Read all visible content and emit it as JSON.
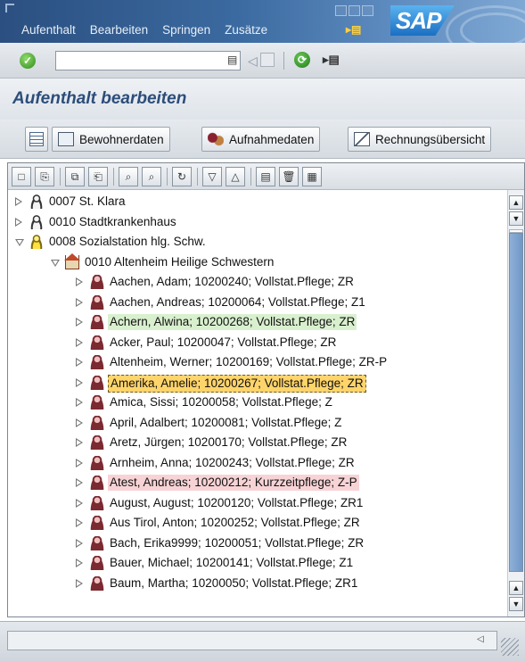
{
  "menubar": {
    "items": [
      "Aufenthalt",
      "Bearbeiten",
      "Springen",
      "Zusätze"
    ],
    "logo": "SAP",
    "accent": "#2b4f80"
  },
  "toolbar": {
    "command_value": "",
    "icons": [
      "ok-icon",
      "history-icon",
      "back-icon",
      "save-icon",
      "shortcut-icon",
      "customize-icon"
    ]
  },
  "page": {
    "title": "Aufenthalt bearbeiten"
  },
  "app_toolbar": {
    "buttons": [
      {
        "label": "",
        "icon": "list-icon"
      },
      {
        "label": "Bewohnerdaten",
        "icon": "resident-icon"
      },
      {
        "label": "Aufnahmedaten",
        "icon": "admission-icon"
      },
      {
        "label": "Rechnungsübersicht",
        "icon": "invoice-icon"
      }
    ]
  },
  "tree_toolbar": {
    "icons": [
      "new-icon",
      "detail-icon",
      "copy-icon",
      "paste-icon",
      "find-icon",
      "find-next-icon",
      "refresh-icon",
      "expand-icon",
      "collapse-icon",
      "print-icon",
      "delete-icon",
      "layout-icon"
    ]
  },
  "tree": {
    "nodes": [
      {
        "level": 0,
        "state": "closed",
        "icon": "org",
        "label": "0007 St. Klara"
      },
      {
        "level": 0,
        "state": "closed",
        "icon": "org",
        "label": "0010 Stadtkrankenhaus"
      },
      {
        "level": 0,
        "state": "open",
        "icon": "station",
        "label": "0008 Sozialstation hlg. Schw."
      },
      {
        "level": 1,
        "state": "open",
        "icon": "home",
        "label": "0010 Altenheim Heilige Schwestern"
      },
      {
        "level": 2,
        "state": "closed",
        "icon": "person",
        "label": "Aachen, Adam; 10200240; Vollstat.Pflege; ZR"
      },
      {
        "level": 2,
        "state": "closed",
        "icon": "person",
        "label": "Aachen, Andreas; 10200064; Vollstat.Pflege; Z1"
      },
      {
        "level": 2,
        "state": "closed",
        "icon": "person",
        "label": "Achern, Alwina; 10200268; Vollstat.Pflege; ZR",
        "highlight": "green"
      },
      {
        "level": 2,
        "state": "closed",
        "icon": "person",
        "label": "Acker, Paul; 10200047; Vollstat.Pflege; ZR"
      },
      {
        "level": 2,
        "state": "closed",
        "icon": "person",
        "label": "Altenheim, Werner; 10200169; Vollstat.Pflege; ZR-P"
      },
      {
        "level": 2,
        "state": "closed",
        "icon": "person",
        "label": "Amerika, Amelie; 10200267; Vollstat.Pflege; ZR",
        "highlight": "selected"
      },
      {
        "level": 2,
        "state": "closed",
        "icon": "person",
        "label": "Amica, Sissi; 10200058; Vollstat.Pflege; Z"
      },
      {
        "level": 2,
        "state": "closed",
        "icon": "person",
        "label": "April, Adalbert; 10200081; Vollstat.Pflege; Z"
      },
      {
        "level": 2,
        "state": "closed",
        "icon": "person",
        "label": "Aretz, Jürgen; 10200170; Vollstat.Pflege; ZR"
      },
      {
        "level": 2,
        "state": "closed",
        "icon": "person",
        "label": "Arnheim, Anna; 10200243; Vollstat.Pflege; ZR"
      },
      {
        "level": 2,
        "state": "closed",
        "icon": "person",
        "label": "Atest, Andreas; 10200212; Kurzzeitpflege; Z-P",
        "highlight": "red"
      },
      {
        "level": 2,
        "state": "closed",
        "icon": "person",
        "label": "August, August; 10200120; Vollstat.Pflege; ZR1"
      },
      {
        "level": 2,
        "state": "closed",
        "icon": "person",
        "label": "Aus Tirol, Anton; 10200252; Vollstat.Pflege; ZR"
      },
      {
        "level": 2,
        "state": "closed",
        "icon": "person",
        "label": "Bach, Erika9999; 10200051; Vollstat.Pflege; ZR"
      },
      {
        "level": 2,
        "state": "closed",
        "icon": "person",
        "label": "Bauer, Michael; 10200141; Vollstat.Pflege; Z1"
      },
      {
        "level": 2,
        "state": "closed",
        "icon": "person",
        "label": "Baum, Martha; 10200050; Vollstat.Pflege; ZR1"
      }
    ]
  },
  "status": {
    "message": ""
  }
}
